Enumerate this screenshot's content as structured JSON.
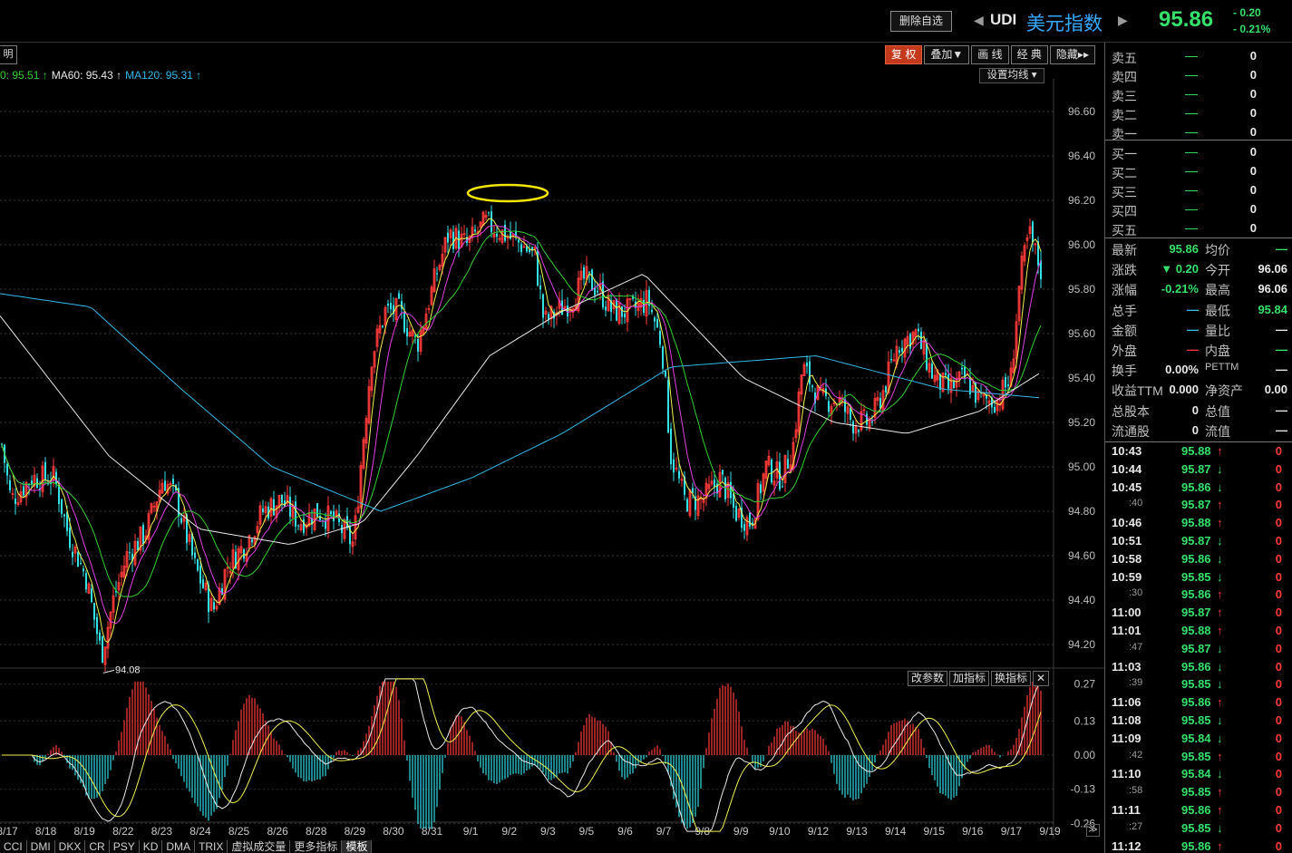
{
  "header": {
    "delete_watch": "删除自选",
    "symbol_code": "UDI",
    "symbol_name": "美元指数",
    "price": "95.86",
    "change": "- 0.20",
    "change_pct": "- 0.21%"
  },
  "toolbar": {
    "left_stub": "明",
    "buttons": [
      {
        "label": "复 权",
        "active": true
      },
      {
        "label": "叠加▼",
        "active": false
      },
      {
        "label": "画 线",
        "active": false
      },
      {
        "label": "经 典",
        "active": false
      },
      {
        "label": "隐藏▸▸",
        "active": false
      }
    ],
    "set_ma": "设置均线 ▾"
  },
  "ma_legend": [
    {
      "text": "0: 95.51 ↑",
      "color": "#30d030"
    },
    {
      "text": "MA60: 95.43 ↑",
      "color": "#e8e8e8"
    },
    {
      "text": "MA120: 95.31 ↑",
      "color": "#33b8e8"
    }
  ],
  "indicator_buttons": [
    "改参数",
    "加指标",
    "换指标",
    "✕"
  ],
  "bottom_tabs": [
    {
      "label": "CCI",
      "active": false
    },
    {
      "label": "DMI",
      "active": false
    },
    {
      "label": "DKX",
      "active": false
    },
    {
      "label": "CR",
      "active": false
    },
    {
      "label": "PSY",
      "active": false
    },
    {
      "label": "KD",
      "active": false
    },
    {
      "label": "DMA",
      "active": false
    },
    {
      "label": "TRIX",
      "active": false
    },
    {
      "label": "虚拟成交量",
      "active": false
    },
    {
      "label": "更多指标",
      "active": false
    },
    {
      "label": "模板",
      "active": true
    }
  ],
  "scroll_right": "≫",
  "order_book": {
    "asks": [
      {
        "label": "卖五",
        "price": "—",
        "vol": "0"
      },
      {
        "label": "卖四",
        "price": "—",
        "vol": "0"
      },
      {
        "label": "卖三",
        "price": "—",
        "vol": "0"
      },
      {
        "label": "卖二",
        "price": "—",
        "vol": "0"
      },
      {
        "label": "卖一",
        "price": "—",
        "vol": "0"
      }
    ],
    "bids": [
      {
        "label": "买一",
        "price": "—",
        "vol": "0"
      },
      {
        "label": "买二",
        "price": "—",
        "vol": "0"
      },
      {
        "label": "买三",
        "price": "—",
        "vol": "0"
      },
      {
        "label": "买四",
        "price": "—",
        "vol": "0"
      },
      {
        "label": "买五",
        "price": "—",
        "vol": "0"
      }
    ]
  },
  "quote_rows": [
    {
      "l1": "最新",
      "v1": "95.86",
      "c1": "#35e06b",
      "l2": "均价",
      "v2": "—",
      "c2": "#35e06b"
    },
    {
      "l1": "涨跌",
      "v1": "▼ 0.20",
      "c1": "#35e06b",
      "l2": "今开",
      "v2": "96.06",
      "c2": "#e8e8e8"
    },
    {
      "l1": "涨幅",
      "v1": "-0.21%",
      "c1": "#35e06b",
      "l2": "最高",
      "v2": "96.06",
      "c2": "#e8e8e8"
    },
    {
      "l1": "总手",
      "v1": "—",
      "c1": "#33b8e8",
      "l2": "最低",
      "v2": "95.84",
      "c2": "#35e06b"
    },
    {
      "l1": "金额",
      "v1": "—",
      "c1": "#33b8e8",
      "l2": "量比",
      "v2": "—",
      "c2": "#e8e8e8"
    },
    {
      "l1": "外盘",
      "v1": "—",
      "c1": "#ff3b3b",
      "l2": "内盘",
      "v2": "—",
      "c2": "#35e06b"
    },
    {
      "l1": "换手",
      "v1": "0.00%",
      "c1": "#e8e8e8",
      "l2": "PETTM",
      "v2": "—",
      "c2": "#e8e8e8"
    },
    {
      "l1": "收益TTM",
      "v1": "0.000",
      "c1": "#e8e8e8",
      "l2": "净资产",
      "v2": "0.00",
      "c2": "#e8e8e8"
    },
    {
      "l1": "总股本",
      "v1": "0",
      "c1": "#e8e8e8",
      "l2": "总值",
      "v2": "—",
      "c2": "#e8e8e8"
    },
    {
      "l1": "流通股",
      "v1": "0",
      "c1": "#e8e8e8",
      "l2": "流值",
      "v2": "—",
      "c2": "#e8e8e8"
    }
  ],
  "ticks": [
    {
      "time": "10:43",
      "sub": false,
      "price": "95.88",
      "dir": "up",
      "vol": "0"
    },
    {
      "time": "10:44",
      "sub": false,
      "price": "95.87",
      "dir": "down",
      "vol": "0"
    },
    {
      "time": "10:45",
      "sub": false,
      "price": "95.86",
      "dir": "down",
      "vol": "0"
    },
    {
      "time": ":40",
      "sub": true,
      "price": "95.87",
      "dir": "up",
      "vol": "0"
    },
    {
      "time": "10:46",
      "sub": false,
      "price": "95.88",
      "dir": "up",
      "vol": "0"
    },
    {
      "time": "10:51",
      "sub": false,
      "price": "95.87",
      "dir": "down",
      "vol": "0"
    },
    {
      "time": "10:58",
      "sub": false,
      "price": "95.86",
      "dir": "down",
      "vol": "0"
    },
    {
      "time": "10:59",
      "sub": false,
      "price": "95.85",
      "dir": "down",
      "vol": "0"
    },
    {
      "time": ":30",
      "sub": true,
      "price": "95.86",
      "dir": "up",
      "vol": "0"
    },
    {
      "time": "11:00",
      "sub": false,
      "price": "95.87",
      "dir": "up",
      "vol": "0"
    },
    {
      "time": "11:01",
      "sub": false,
      "price": "95.88",
      "dir": "up",
      "vol": "0"
    },
    {
      "time": ":47",
      "sub": true,
      "price": "95.87",
      "dir": "down",
      "vol": "0"
    },
    {
      "time": "11:03",
      "sub": false,
      "price": "95.86",
      "dir": "down",
      "vol": "0"
    },
    {
      "time": ":39",
      "sub": true,
      "price": "95.85",
      "dir": "down",
      "vol": "0"
    },
    {
      "time": "11:06",
      "sub": false,
      "price": "95.86",
      "dir": "up",
      "vol": "0"
    },
    {
      "time": "11:08",
      "sub": false,
      "price": "95.85",
      "dir": "down",
      "vol": "0"
    },
    {
      "time": "11:09",
      "sub": false,
      "price": "95.84",
      "dir": "down",
      "vol": "0"
    },
    {
      "time": ":42",
      "sub": true,
      "price": "95.85",
      "dir": "up",
      "vol": "0"
    },
    {
      "time": "11:10",
      "sub": false,
      "price": "95.84",
      "dir": "down",
      "vol": "0"
    },
    {
      "time": ":58",
      "sub": true,
      "price": "95.85",
      "dir": "up",
      "vol": "0"
    },
    {
      "time": "11:11",
      "sub": false,
      "price": "95.86",
      "dir": "up",
      "vol": "0"
    },
    {
      "time": ":27",
      "sub": true,
      "price": "95.85",
      "dir": "down",
      "vol": "0"
    },
    {
      "time": "11:12",
      "sub": false,
      "price": "95.86",
      "dir": "up",
      "vol": "0"
    }
  ],
  "colors": {
    "up": "#ff3b3b",
    "down": "#33e0e6",
    "ma_short": "#f0f050",
    "ma_mid": "#e040e0",
    "ma_long": "#30d030",
    "ma60": "#e8e8e8",
    "ma120": "#33b8e8",
    "annotation": "#f2e600"
  },
  "chart_data": {
    "type": "candlestick",
    "price_axis": {
      "ticks": [
        96.6,
        96.4,
        96.2,
        96.0,
        95.8,
        95.6,
        95.4,
        95.2,
        95.0,
        94.8,
        94.6,
        94.4,
        94.2
      ],
      "labels": [
        "96.60",
        "96.40",
        "96.20",
        "96.00",
        "95.80",
        "95.60",
        "95.40",
        "95.20",
        "95.00",
        "94.80",
        "94.60",
        "94.40",
        "94.20"
      ],
      "range": [
        94.08,
        96.72
      ]
    },
    "low_marker": {
      "value": 94.08,
      "label": "94.08"
    },
    "date_labels": [
      "8/17",
      "8/18",
      "8/19",
      "8/22",
      "8/23",
      "8/24",
      "8/25",
      "8/26",
      "8/28",
      "8/29",
      "8/30",
      "8/31",
      "9/1",
      "9/2",
      "9/3",
      "9/5",
      "9/6",
      "9/7",
      "9/8",
      "9/9",
      "9/10",
      "9/12",
      "9/13",
      "9/14",
      "9/15",
      "9/16",
      "9/17",
      "9/19"
    ],
    "anchors": [
      [
        0,
        95.15
      ],
      [
        12,
        94.85
      ],
      [
        35,
        94.95
      ],
      [
        60,
        94.95
      ],
      [
        75,
        94.7
      ],
      [
        95,
        94.5
      ],
      [
        112,
        94.15
      ],
      [
        125,
        94.4
      ],
      [
        140,
        94.6
      ],
      [
        160,
        94.7
      ],
      [
        180,
        94.95
      ],
      [
        195,
        94.85
      ],
      [
        215,
        94.55
      ],
      [
        235,
        94.35
      ],
      [
        250,
        94.55
      ],
      [
        270,
        94.65
      ],
      [
        290,
        94.8
      ],
      [
        310,
        94.85
      ],
      [
        330,
        94.75
      ],
      [
        350,
        94.8
      ],
      [
        370,
        94.75
      ],
      [
        390,
        94.65
      ],
      [
        400,
        95.1
      ],
      [
        410,
        95.5
      ],
      [
        425,
        95.7
      ],
      [
        440,
        95.7
      ],
      [
        460,
        95.55
      ],
      [
        480,
        95.85
      ],
      [
        495,
        96.05
      ],
      [
        515,
        96.0
      ],
      [
        535,
        96.1
      ],
      [
        555,
        96.05
      ],
      [
        575,
        96.0
      ],
      [
        590,
        95.95
      ],
      [
        600,
        95.65
      ],
      [
        615,
        95.7
      ],
      [
        630,
        95.75
      ],
      [
        645,
        95.85
      ],
      [
        660,
        95.8
      ],
      [
        675,
        95.7
      ],
      [
        695,
        95.7
      ],
      [
        715,
        95.75
      ],
      [
        730,
        95.55
      ],
      [
        740,
        95.05
      ],
      [
        755,
        94.85
      ],
      [
        775,
        94.85
      ],
      [
        795,
        94.95
      ],
      [
        810,
        94.8
      ],
      [
        828,
        94.75
      ],
      [
        845,
        95.0
      ],
      [
        862,
        94.95
      ],
      [
        875,
        95.1
      ],
      [
        885,
        95.45
      ],
      [
        905,
        95.3
      ],
      [
        925,
        95.3
      ],
      [
        940,
        95.2
      ],
      [
        960,
        95.2
      ],
      [
        975,
        95.35
      ],
      [
        990,
        95.55
      ],
      [
        1010,
        95.6
      ],
      [
        1030,
        95.4
      ],
      [
        1045,
        95.35
      ],
      [
        1065,
        95.4
      ],
      [
        1080,
        95.3
      ],
      [
        1100,
        95.3
      ],
      [
        1115,
        95.4
      ],
      [
        1125,
        95.85
      ],
      [
        1135,
        96.05
      ],
      [
        1150,
        95.86
      ]
    ],
    "ma_series": [
      {
        "name": "MA60",
        "value": 95.43
      },
      {
        "name": "MA120",
        "value": 95.31
      }
    ],
    "ma_anchors": {
      "ma120": [
        [
          0,
          95.78
        ],
        [
          100,
          95.72
        ],
        [
          200,
          95.35
        ],
        [
          300,
          95.0
        ],
        [
          420,
          94.8
        ],
        [
          520,
          94.95
        ],
        [
          620,
          95.15
        ],
        [
          740,
          95.45
        ],
        [
          900,
          95.5
        ],
        [
          1040,
          95.35
        ],
        [
          1150,
          95.31
        ]
      ],
      "ma60": [
        [
          0,
          95.68
        ],
        [
          120,
          95.05
        ],
        [
          220,
          94.72
        ],
        [
          320,
          94.65
        ],
        [
          400,
          94.75
        ],
        [
          460,
          95.05
        ],
        [
          540,
          95.5
        ],
        [
          620,
          95.7
        ],
        [
          710,
          95.87
        ],
        [
          820,
          95.4
        ],
        [
          920,
          95.2
        ],
        [
          1000,
          95.15
        ],
        [
          1080,
          95.25
        ],
        [
          1150,
          95.43
        ]
      ]
    },
    "macd": {
      "axis_labels": [
        "0.27",
        "0.13",
        "0.00",
        "-0.13",
        "-0.26"
      ],
      "axis_values": [
        0.27,
        0.13,
        0.0,
        -0.13,
        -0.26
      ],
      "range": [
        -0.3,
        0.3
      ]
    }
  }
}
